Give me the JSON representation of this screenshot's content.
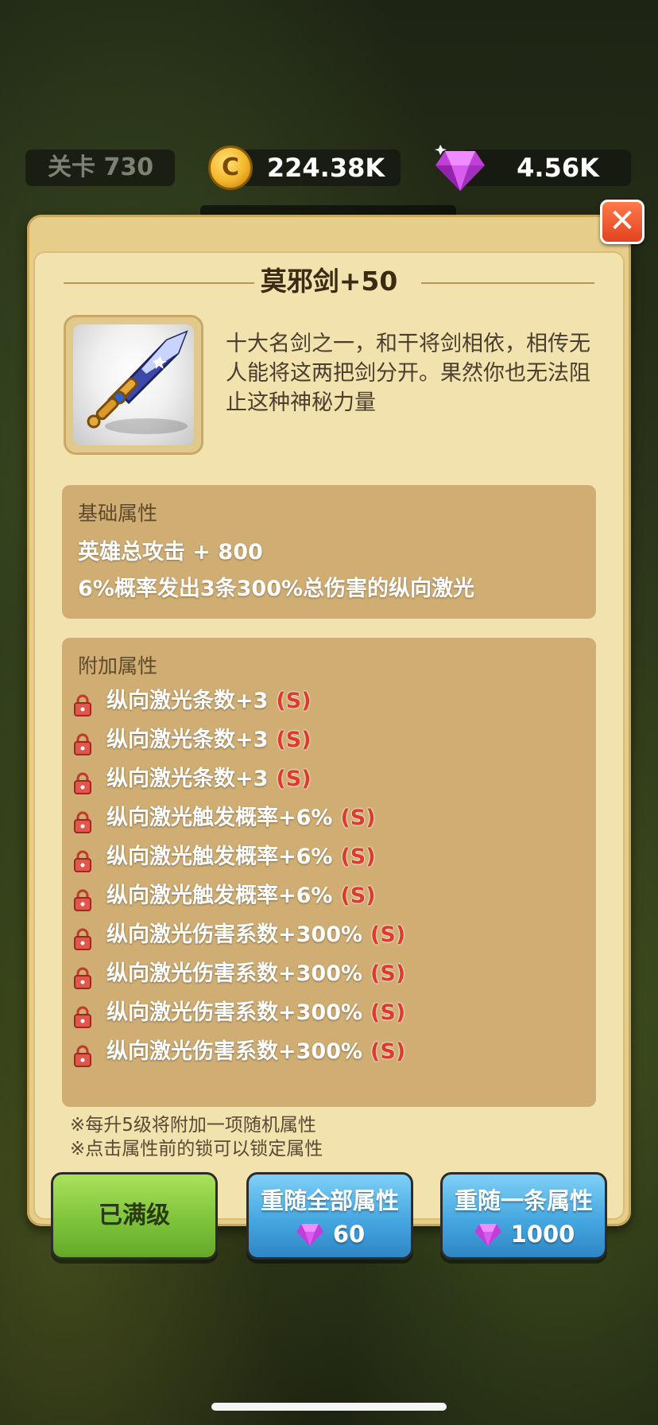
{
  "hud": {
    "level": "关卡 730",
    "gold": "224.38K",
    "coin_letter": "C",
    "gems": "4.56K"
  },
  "item": {
    "title": "莫邪剑+50",
    "description": "十大名剑之一，和干将剑相依，相传无人能将这两把剑分开。果然你也无法阻止这种神秘力量",
    "icon": "sword-icon"
  },
  "base": {
    "heading": "基础属性",
    "lines": [
      "英雄总攻击 + 800",
      "6%概率发出3条300%总伤害的纵向激光"
    ]
  },
  "extra": {
    "heading": "附加属性",
    "grade_label": "(S)",
    "rows": [
      "纵向激光条数+3",
      "纵向激光条数+3",
      "纵向激光条数+3",
      "纵向激光触发概率+6%",
      "纵向激光触发概率+6%",
      "纵向激光触发概率+6%",
      "纵向激光伤害系数+300%",
      "纵向激光伤害系数+300%",
      "纵向激光伤害系数+300%",
      "纵向激光伤害系数+300%"
    ]
  },
  "notes": [
    "※每升5级将附加一项随机属性",
    "※点击属性前的锁可以锁定属性"
  ],
  "buttons": {
    "max_label": "已满级",
    "reroll_all_label": "重随全部属性",
    "reroll_all_cost": "60",
    "reroll_one_label": "重随一条属性",
    "reroll_one_cost": "1000"
  },
  "close_glyph": "✕",
  "colors": {
    "accent_green": "#7ec43b",
    "accent_blue": "#45a7e0",
    "grade_red": "#e03a2a"
  }
}
